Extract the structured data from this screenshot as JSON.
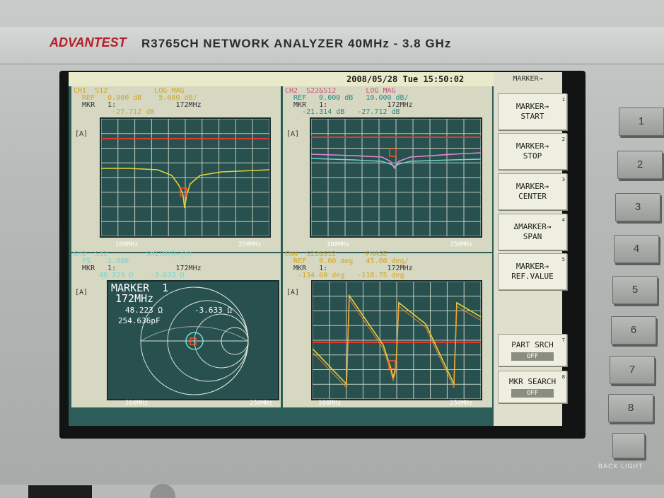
{
  "header": {
    "brand": "ADVANTEST",
    "model": "R3765CH  NETWORK  ANALYZER  40MHz - 3.8 GHz"
  },
  "datetime": "2008/05/28 Tue 15:50:02",
  "softkey_menu_title": "MARKER→",
  "softkeys": [
    {
      "line1": "MARKER→",
      "line2": "START",
      "num": "1"
    },
    {
      "line1": "MARKER→",
      "line2": "STOP",
      "num": "2"
    },
    {
      "line1": "MARKER→",
      "line2": "CENTER",
      "num": "3"
    },
    {
      "line1": "ΔMARKER→",
      "line2": "SPAN",
      "num": "4"
    },
    {
      "line1": "MARKER→",
      "line2": "REF.VALUE",
      "num": "5"
    }
  ],
  "part_srch": {
    "label": "PART SRCH",
    "state": "OFF",
    "num": "7"
  },
  "mkr_search": {
    "label": "MKR SEARCH",
    "state": "OFF",
    "num": "8"
  },
  "hardkeys": [
    "1",
    "2",
    "3",
    "4",
    "5",
    "6",
    "7",
    "8"
  ],
  "backlight_label": "BACK LIGHT",
  "channels": {
    "ch1": {
      "line1": "CH1  S12           LOG MAG",
      "line2": "  REF   0.000 dB    5.000 dB/",
      "line3": "  MKR   1:              172MHz",
      "line4": "         -27.712 dB",
      "tag": "[A]",
      "start": "100MHz",
      "stop": "250MHz"
    },
    "ch2": {
      "line1": "CH2  S22&S12       LOG MAG",
      "line2": "  REF   0.000 dB   10.000 dB/",
      "line3": "  MKR   1:              172MHz",
      "line4": "    -21.314 dB   -27.712 dB",
      "tag": "[A]",
      "start": "100MHz",
      "stop": "250MHz"
    },
    "ch3": {
      "line1": "CH3  S12         SMITH(R+jX)",
      "line2": "  FS    1.000",
      "line3": "  MKR   1:              172MHz",
      "line4": "      48.223 Ω    -3.633 Ω",
      "tag": "[A]",
      "start": "100MHz",
      "stop": "250MHz",
      "marker_box": {
        "title": "MARKER  1",
        "freq": "172MHz",
        "r": "48.223 Ω",
        "x": "-3.633 Ω",
        "c": "254.636pF"
      }
    },
    "ch4": {
      "line1": "CH4  S22&S12       PHASE",
      "line2": "  REF   0.00 deg   45.00 deg/",
      "line3": "  MKR   1:              172MHz",
      "line4": "   -134.60 deg   -118.75 deg",
      "tag": "[A]",
      "start": "100MHz",
      "stop": "250MHz"
    }
  },
  "colors": {
    "trace_yellow": "#e7d23a",
    "trace_pink": "#e58ad0",
    "trace_cyan": "#6fd6d0",
    "ref_red": "#e33b2d",
    "marker_orange": "#ff5a2a"
  }
}
